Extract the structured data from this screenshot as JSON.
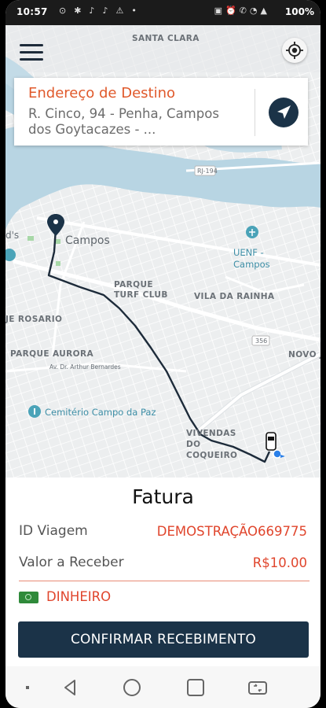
{
  "status_bar": {
    "time": "10:57",
    "left_icons": [
      "messenger-icon",
      "bluetooth-icon",
      "tiktok-icon",
      "tiktok-icon",
      "warning-icon",
      "dot-icon"
    ],
    "right_icons": [
      "image-icon",
      "alarm-icon",
      "vibrate-icon",
      "wifi-icon",
      "signal-icon"
    ],
    "battery": "100%"
  },
  "map": {
    "labels": {
      "santa_clara": "SANTA CLARA",
      "campos": "Campos",
      "parque_turf_club": "PARQUE TURF CLUB",
      "vila_da_rainha": "VILA DA RAINHA",
      "rosario": "JE ROSARIO",
      "parque_aurora": "PARQUE AURORA",
      "street_arthur": "Av. Dr. Arthur Bernardes",
      "novo_j": "NOVO J",
      "cemiterio": "Cemitério Campo da Paz",
      "vivendas": "VIVENDAS DO COQUEIRO",
      "uenf": "UENF - Campos",
      "mcdonalds": "d's",
      "rj194": "RJ-194",
      "route_356": "356"
    }
  },
  "destination": {
    "title": "Endereço de Destino",
    "address": "R. Cinco, 94 - Penha, Campos dos Goytacazes - ..."
  },
  "invoice": {
    "title": "Fatura",
    "trip_id_label": "ID Viagem",
    "trip_id_value": "DEMOSTRAÇÃO669775",
    "amount_label": "Valor a Receber",
    "amount_value": "R$10.00",
    "payment_method": "DINHEIRO",
    "confirm_label": "CONFIRMAR RECEBIMENTO"
  },
  "colors": {
    "accent": "#e0452c",
    "primary_dark": "#1b3348",
    "map_water": "#b8d5e3",
    "map_land": "#eceeef",
    "route": "#1d2b3a"
  }
}
